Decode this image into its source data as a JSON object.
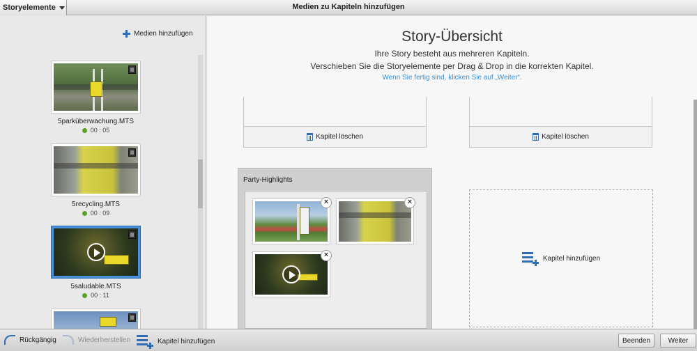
{
  "topbar": {
    "dropdown_label": "Storyelemente",
    "window_title": "Medien zu Kapiteln hinzufügen"
  },
  "left_panel": {
    "add_media_label": "Medien hinzufügen",
    "clips": [
      {
        "name": "5parküberwachung.MTS",
        "duration": "00 : 05"
      },
      {
        "name": "5recycling.MTS",
        "duration": "00 : 09"
      },
      {
        "name": "5saludable.MTS",
        "duration": "00 : 11"
      }
    ]
  },
  "main": {
    "title": "Story-Übersicht",
    "subtitle_1": "Ihre Story besteht aus mehreren Kapiteln.",
    "subtitle_2": "Verschieben Sie die Storyelemente per Drag & Drop in die korrekten Kapitel.",
    "hint": "Wenn Sie fertig sind, klicken Sie auf „Weiter“.",
    "delete_chapter_label": "Kapitel löschen",
    "party_chapter_title": "Party-Highlights",
    "remove_symbol": "×",
    "add_chapter_label": "Kapitel hinzufügen"
  },
  "bottombar": {
    "undo_label": "Rückgängig",
    "redo_label": "Wiederherstellen",
    "add_chapter_label": "Kapitel hinzufügen",
    "finish_label": "Beenden",
    "next_label": "Weiter"
  },
  "colors": {
    "accent": "#2f6db5",
    "hint": "#3a8fd2",
    "selection": "#4a90d9",
    "status_ready": "#5aa02c"
  }
}
